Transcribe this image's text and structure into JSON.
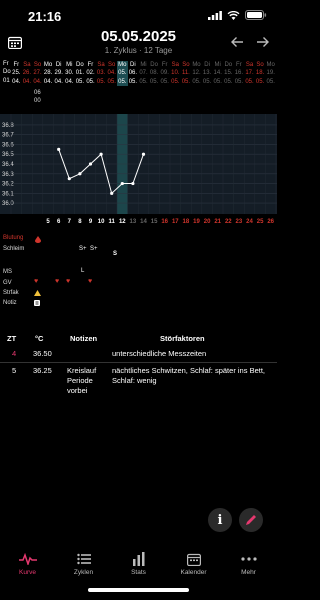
{
  "status_bar": {
    "time": "21:16"
  },
  "header": {
    "date": "05.05.2025",
    "subtitle": "1. Zyklus · 12 Tage"
  },
  "grid": {
    "row_labels": [
      "Fr",
      "Do",
      "01"
    ],
    "weekdays": [
      "Fr",
      "Sa",
      "So",
      "Mo",
      "Di",
      "Mi",
      "Do",
      "Fr",
      "Sa",
      "So",
      "Mo",
      "Di",
      "Mi",
      "Do",
      "Fr",
      "Sa",
      "So",
      "Mo",
      "Di",
      "Mi",
      "Do",
      "Fr",
      "Sa",
      "So",
      "Mo"
    ],
    "days": [
      "25.",
      "26.",
      "27.",
      "28.",
      "29.",
      "30.",
      "01.",
      "02.",
      "03.",
      "04.",
      "05.",
      "06.",
      "07.",
      "08.",
      "09.",
      "10.",
      "11.",
      "12.",
      "13.",
      "14.",
      "15.",
      "16.",
      "17.",
      "18.",
      "19."
    ],
    "months": [
      "04.",
      "04.",
      "04.",
      "04.",
      "04.",
      "04.",
      "05.",
      "05.",
      "05.",
      "05.",
      "05.",
      "05.",
      "05.",
      "05.",
      "05.",
      "05.",
      "05.",
      "05.",
      "05.",
      "05.",
      "05.",
      "05.",
      "05.",
      "05.",
      "05."
    ],
    "time_label_1": "06",
    "time_label_2": "00",
    "weekend_color": "#d0352c",
    "today_color": "#1d4d52"
  },
  "chart_data": {
    "type": "line",
    "y_ticks": [
      "36.8",
      "36.7",
      "36.6",
      "36.5",
      "36.4",
      "36.3",
      "36.2",
      "36.1",
      "36.0"
    ],
    "ylim": [
      35.95,
      36.85
    ],
    "cycle_days": [
      "",
      "",
      "",
      "5",
      "6",
      "7",
      "8",
      "9",
      "10",
      "11",
      "12",
      "13",
      "14",
      "15",
      "16",
      "17",
      "18",
      "19",
      "20",
      "21",
      "22",
      "23",
      "24",
      "25",
      "26"
    ],
    "series": [
      {
        "values": [
          {
            "x": 4,
            "y": 36.55
          },
          {
            "x": 5,
            "y": 36.25
          },
          {
            "x": 6,
            "y": 36.3
          },
          {
            "x": 7,
            "y": 36.4
          },
          {
            "x": 8,
            "y": 36.5
          },
          {
            "x": 9,
            "y": 36.1
          },
          {
            "x": 10,
            "y": 36.2
          },
          {
            "x": 11,
            "y": 36.2
          },
          {
            "x": 12,
            "y": 36.5
          }
        ]
      }
    ]
  },
  "panel": {
    "labels": [
      "Blutung",
      "Schleim",
      "MS",
      "GV",
      "Strfak",
      "Notiz"
    ],
    "schleim_marks": [
      "S+",
      "S+",
      "S"
    ],
    "ms_mark": "L"
  },
  "table": {
    "headers": [
      "ZT",
      "°C",
      "Notizen",
      "Störfaktoren"
    ],
    "rows": [
      {
        "zt": "4",
        "temp": "36.50",
        "notes": "",
        "factors": "unterschiedliche Messzeiten"
      },
      {
        "zt": "5",
        "temp": "36.25",
        "notes": "Kreislauf Periode vorbei",
        "factors": "nächtliches Schwitzen, Schlaf: später ins Bett, Schlaf: wenig"
      }
    ]
  },
  "tabs": [
    {
      "label": "Kurve",
      "icon": "curve-icon",
      "active": true
    },
    {
      "label": "Zyklen",
      "icon": "list-icon",
      "active": false
    },
    {
      "label": "Stats",
      "icon": "stats-icon",
      "active": false
    },
    {
      "label": "Kalender",
      "icon": "calendar-icon",
      "active": false
    },
    {
      "label": "Mehr",
      "icon": "more-icon",
      "active": false
    }
  ],
  "colors": {
    "accent": "#e5386f",
    "grid_bg": "#141d26",
    "today_col": "#1d4d52"
  }
}
